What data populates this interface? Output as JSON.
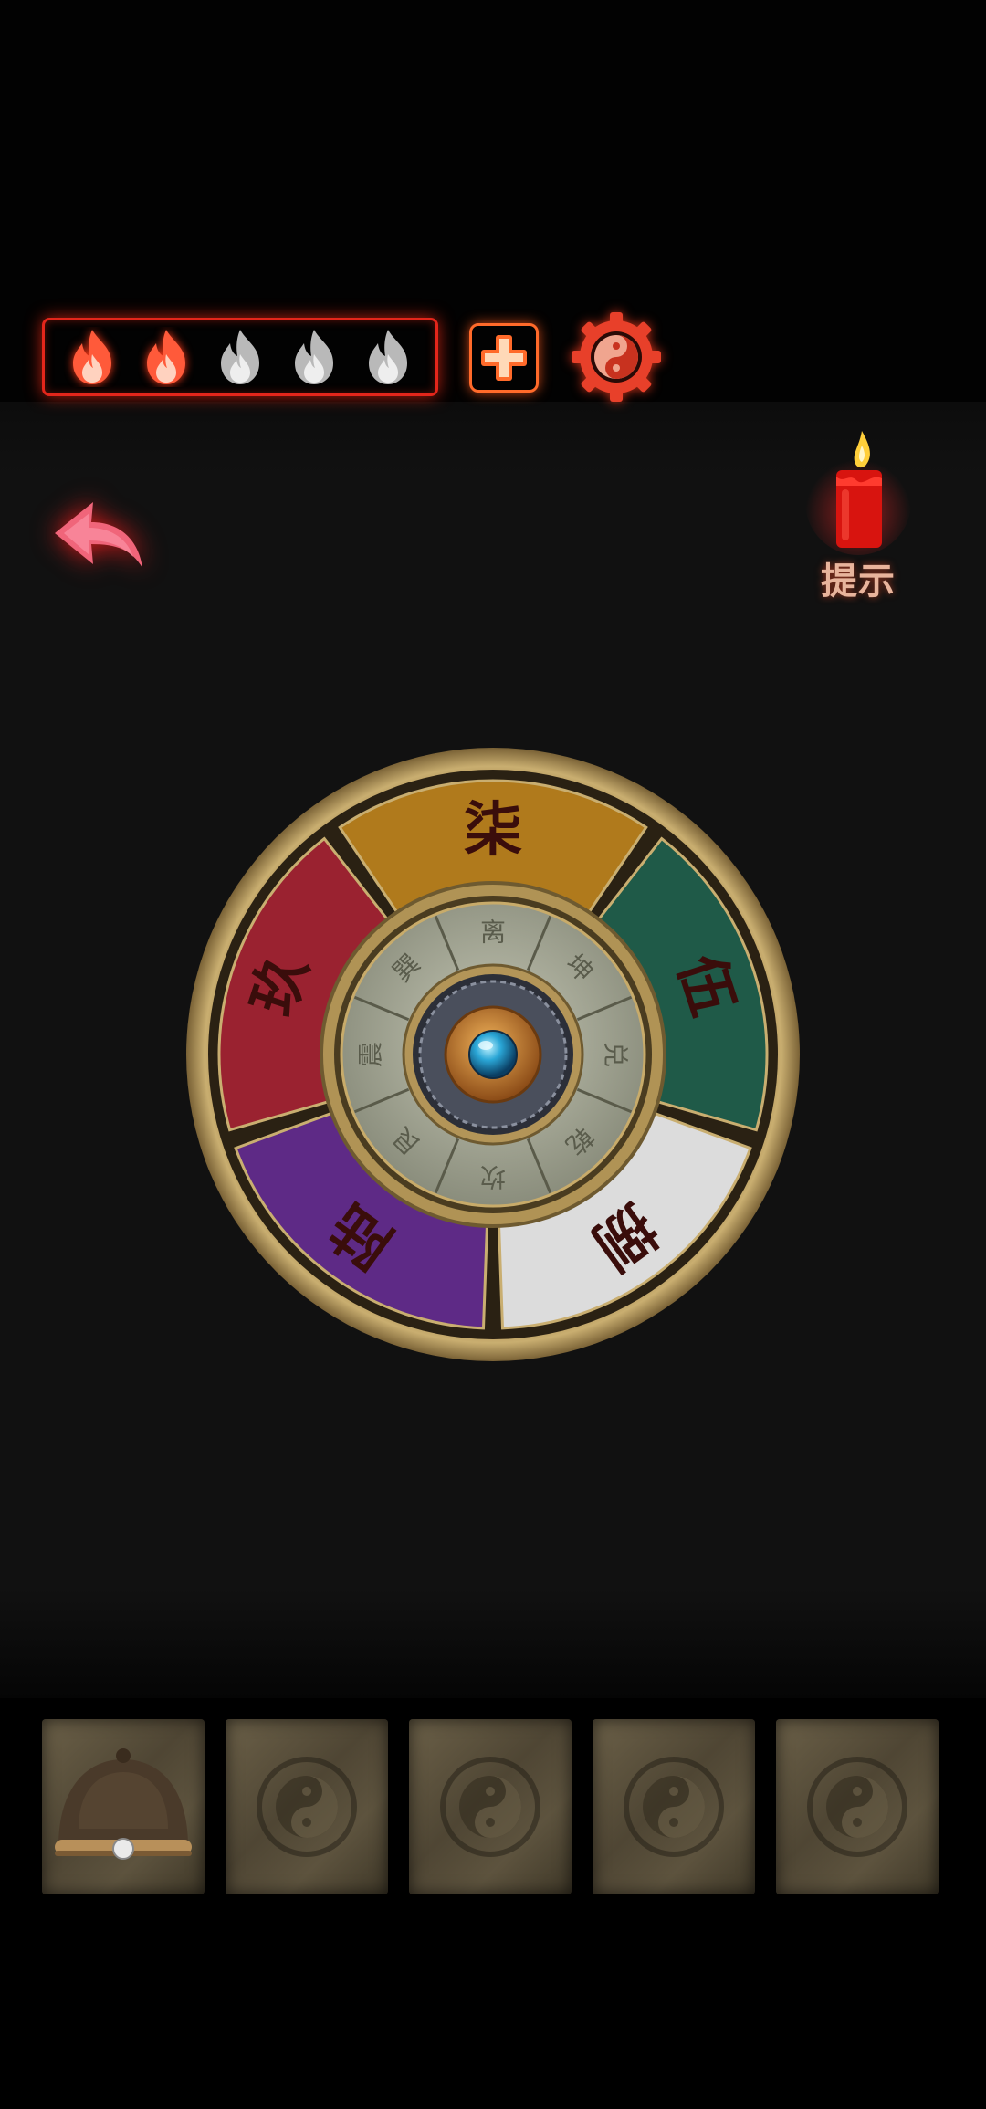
{
  "hud": {
    "lives": {
      "filled": 2,
      "total": 5
    },
    "add_life_icon": "plus-icon",
    "settings_icon": "yin-yang-gear-icon",
    "colors": {
      "accent": "#e3261b",
      "flame_active": "#ff5a3a",
      "flame_inactive": "#b9b9b9"
    }
  },
  "nav": {
    "back_icon": "back-arrow-icon"
  },
  "hint": {
    "label": "提示",
    "icon": "candle-icon"
  },
  "wheel": {
    "outer_segments": [
      {
        "label": "柒",
        "color": "#b07a1c"
      },
      {
        "label": "伍",
        "color": "#1f5a48"
      },
      {
        "label": "捌",
        "color": "#dcdcdc"
      },
      {
        "label": "陆",
        "color": "#5e2a86"
      },
      {
        "label": "玖",
        "color": "#9a2230"
      }
    ],
    "inner_ring": [
      "离",
      "坤",
      "兑",
      "乾",
      "坎",
      "艮",
      "震",
      "巽"
    ],
    "center_icon": "blue-gem-icon"
  },
  "inventory": {
    "slots": [
      {
        "item": "hat",
        "icon": "hat-icon"
      },
      {
        "item": "empty",
        "icon": "bagua-icon"
      },
      {
        "item": "empty",
        "icon": "bagua-icon"
      },
      {
        "item": "empty",
        "icon": "bagua-icon"
      },
      {
        "item": "empty",
        "icon": "bagua-icon"
      }
    ]
  }
}
